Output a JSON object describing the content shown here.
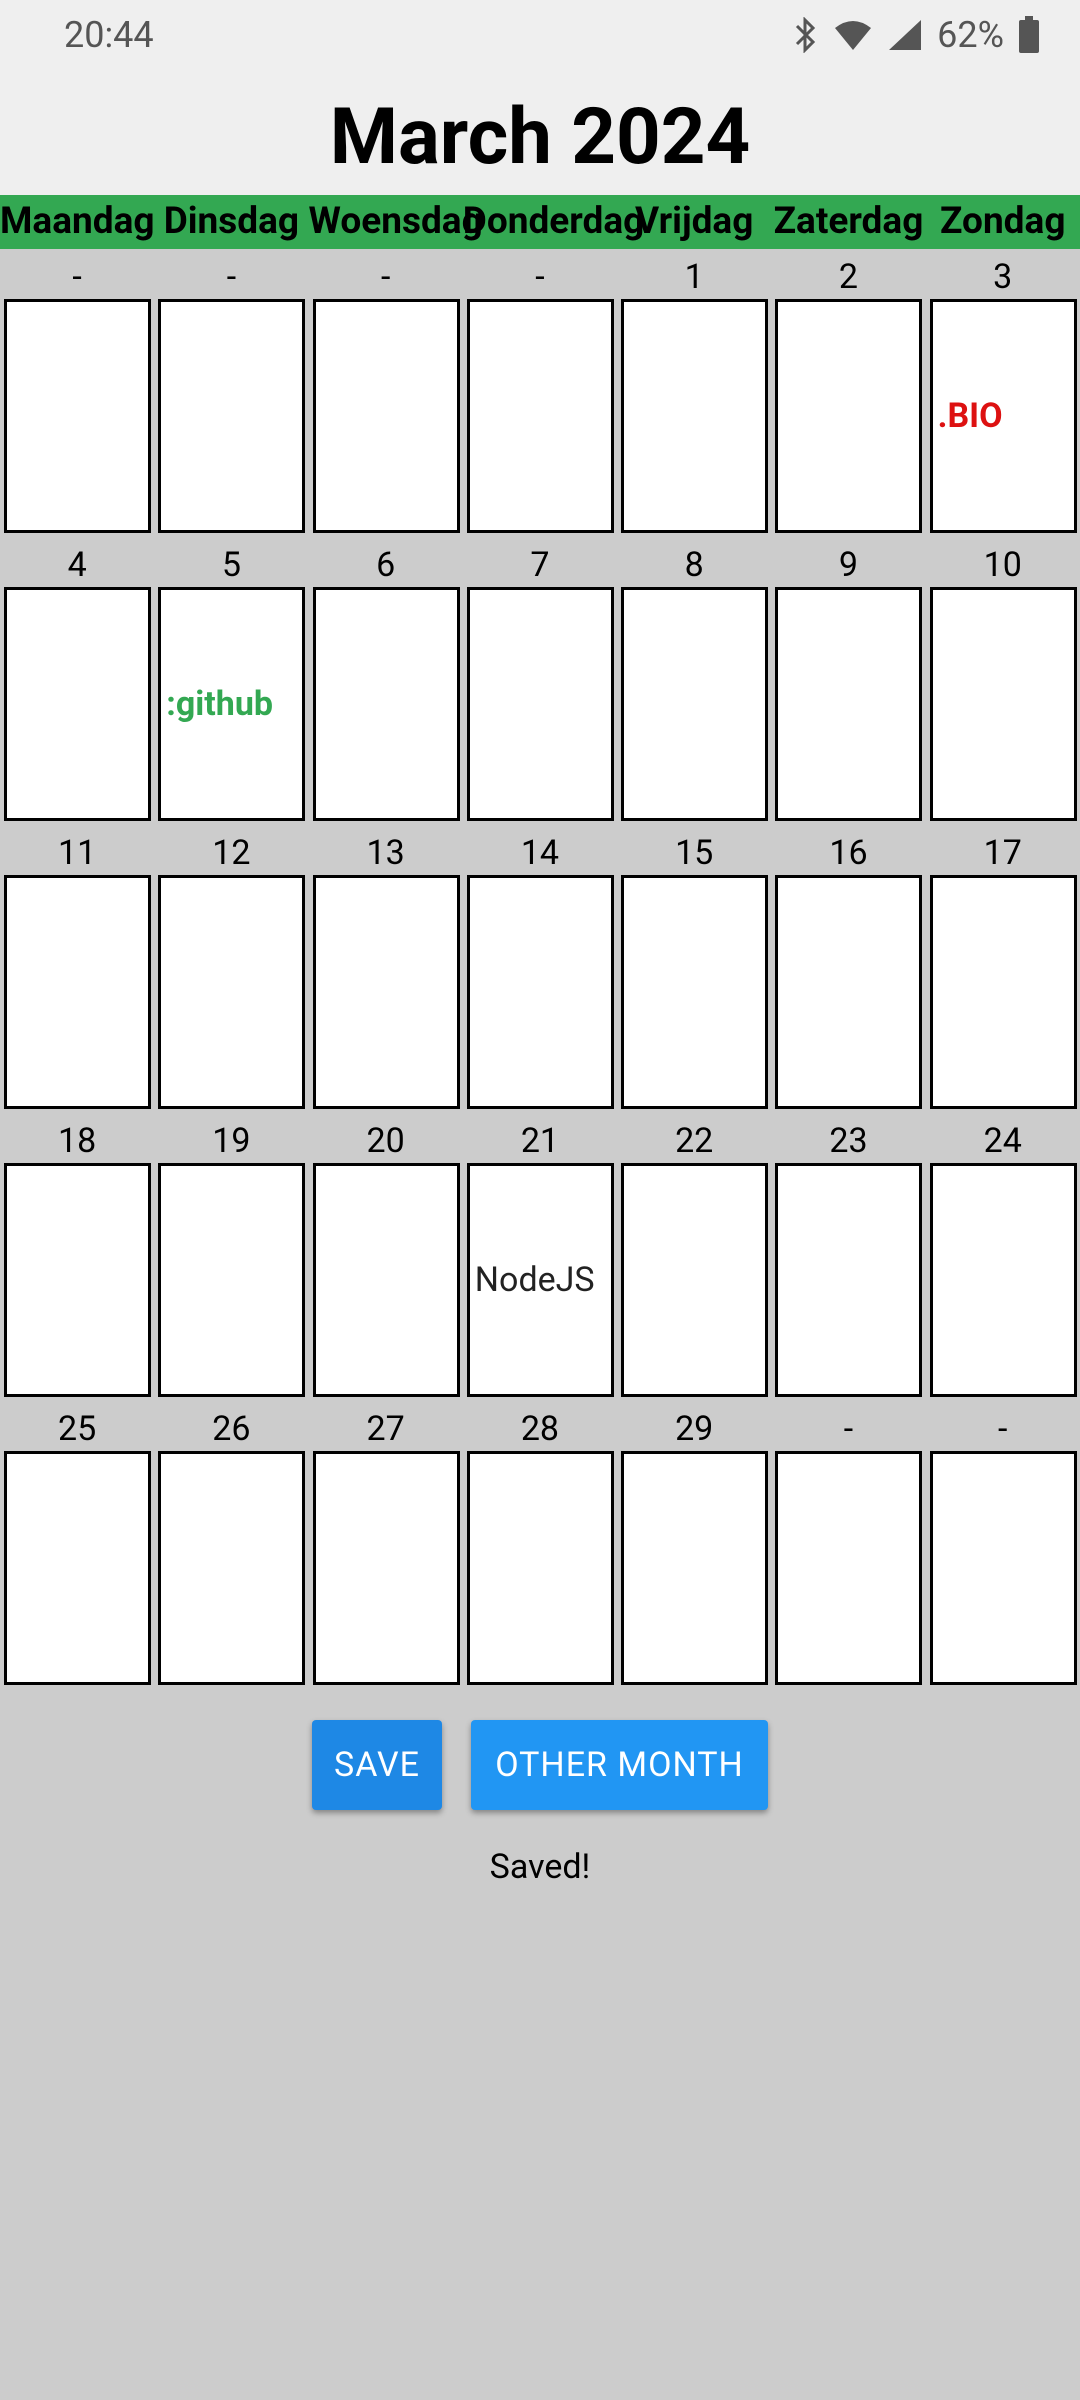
{
  "status": {
    "time": "20:44",
    "battery": "62%"
  },
  "header": {
    "title": "March 2024"
  },
  "weekdays": [
    "Maandag",
    "Dinsdag",
    "Woensdag",
    "Donderdag",
    "Vrijdag",
    "Zaterdag",
    "Zondag"
  ],
  "weeks": [
    {
      "days": [
        "-",
        "-",
        "-",
        "-",
        "1",
        "2",
        "3"
      ],
      "notes": [
        "",
        "",
        "",
        "",
        "",
        "",
        ".BIO"
      ]
    },
    {
      "days": [
        "4",
        "5",
        "6",
        "7",
        "8",
        "9",
        "10"
      ],
      "notes": [
        "",
        ":github",
        "",
        "",
        "",
        "",
        ""
      ]
    },
    {
      "days": [
        "11",
        "12",
        "13",
        "14",
        "15",
        "16",
        "17"
      ],
      "notes": [
        "",
        "",
        "",
        "",
        "",
        "",
        ""
      ]
    },
    {
      "days": [
        "18",
        "19",
        "20",
        "21",
        "22",
        "23",
        "24"
      ],
      "notes": [
        "",
        "",
        "",
        "NodeJS",
        "",
        "",
        ""
      ]
    },
    {
      "days": [
        "25",
        "26",
        "27",
        "28",
        "29",
        "-",
        "-"
      ],
      "notes": [
        "",
        "",
        "",
        "",
        "",
        "",
        ""
      ]
    }
  ],
  "buttons": {
    "save": "SAVE",
    "other_month": "OTHER MONTH"
  },
  "save_status": "Saved!",
  "colors": {
    "weekday_bar": "#33a852",
    "button": "#2196f3",
    "bio_note": "#dd1111",
    "github_note": "#33a852"
  }
}
